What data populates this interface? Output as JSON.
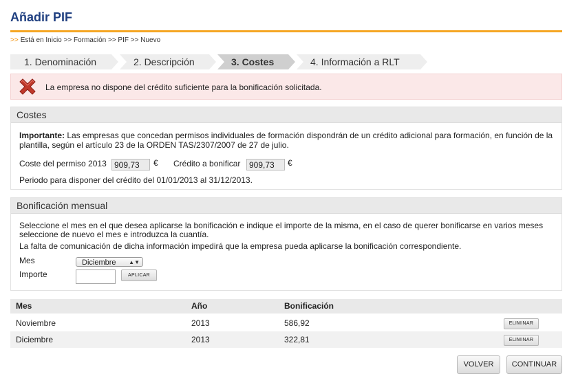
{
  "page": {
    "title": "Añadir PIF",
    "breadcrumb_arrows": ">>",
    "breadcrumb": "Está en Inicio >> Formación >> PIF >> Nuevo"
  },
  "steps": [
    {
      "label": "1. Denominación",
      "active": false
    },
    {
      "label": "2. Descripción",
      "active": false
    },
    {
      "label": "3. Costes",
      "active": true
    },
    {
      "label": "4. Información a RLT",
      "active": false
    }
  ],
  "error": {
    "message": "La empresa no dispone del crédito suficiente para la bonificación solicitada.",
    "icon": "red-x-icon"
  },
  "costes": {
    "header": "Costes",
    "important_label": "Importante:",
    "important_text": " Las empresas que concedan permisos individuales de formación dispondrán de un crédito adicional para formación, en función de la plantilla, según el artículo 23 de la ORDEN TAS/2307/2007 de 27 de julio.",
    "coste_label": "Coste del permiso 2013",
    "coste_value": "909,73",
    "credito_label": "Crédito a bonificar",
    "credito_value": "909,73",
    "currency": "€",
    "periodo_text": "Periodo para disponer del crédito  del 01/01/2013 al 31/12/2013."
  },
  "bonificacion": {
    "header": "Bonificación mensual",
    "instructions_1": "Seleccione el mes en el que desea aplicarse la bonificación e indique el importe de la misma, en el caso de querer bonificarse en varios meses seleccione de nuevo el mes e introduzca la cuantía.",
    "instructions_2": "La falta de comunicación de dicha información impedirá que la empresa pueda aplicarse la bonificación correspondiente.",
    "mes_label": "Mes",
    "mes_selected": "Diciembre",
    "importe_label": "Importe",
    "importe_value": "",
    "apply_label": "APLICAR"
  },
  "table": {
    "headers": {
      "mes": "Mes",
      "anio": "Año",
      "bonificacion": "Bonificación"
    },
    "rows": [
      {
        "mes": "Noviembre",
        "anio": "2013",
        "bonificacion": "586,92",
        "action": "ELIMINAR"
      },
      {
        "mes": "Diciembre",
        "anio": "2013",
        "bonificacion": "322,81",
        "action": "ELIMINAR"
      }
    ]
  },
  "actions": {
    "back": "VOLVER",
    "continue": "CONTINUAR"
  },
  "colors": {
    "title": "#1f3f80",
    "accent_rule": "#f5a623",
    "error_bg": "#fbe8e8",
    "error_icon": "#c0392b"
  }
}
